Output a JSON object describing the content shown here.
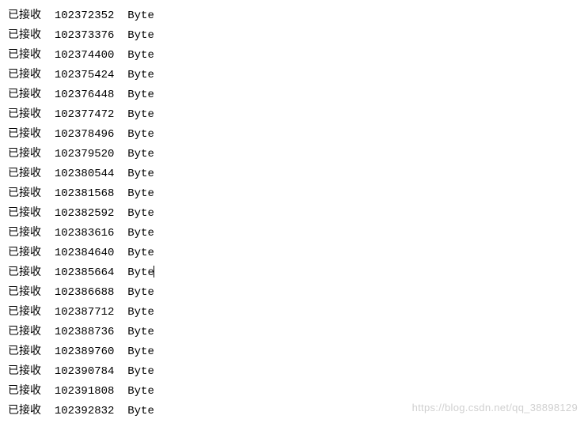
{
  "log_label": "已接收",
  "unit": "Byte",
  "cursor_line_index": 13,
  "lines": [
    {
      "value": "102372352"
    },
    {
      "value": "102373376"
    },
    {
      "value": "102374400"
    },
    {
      "value": "102375424"
    },
    {
      "value": "102376448"
    },
    {
      "value": "102377472"
    },
    {
      "value": "102378496"
    },
    {
      "value": "102379520"
    },
    {
      "value": "102380544"
    },
    {
      "value": "102381568"
    },
    {
      "value": "102382592"
    },
    {
      "value": "102383616"
    },
    {
      "value": "102384640"
    },
    {
      "value": "102385664"
    },
    {
      "value": "102386688"
    },
    {
      "value": "102387712"
    },
    {
      "value": "102388736"
    },
    {
      "value": "102389760"
    },
    {
      "value": "102390784"
    },
    {
      "value": "102391808"
    },
    {
      "value": "102392832"
    }
  ],
  "watermark": "https://blog.csdn.net/qq_38898129"
}
